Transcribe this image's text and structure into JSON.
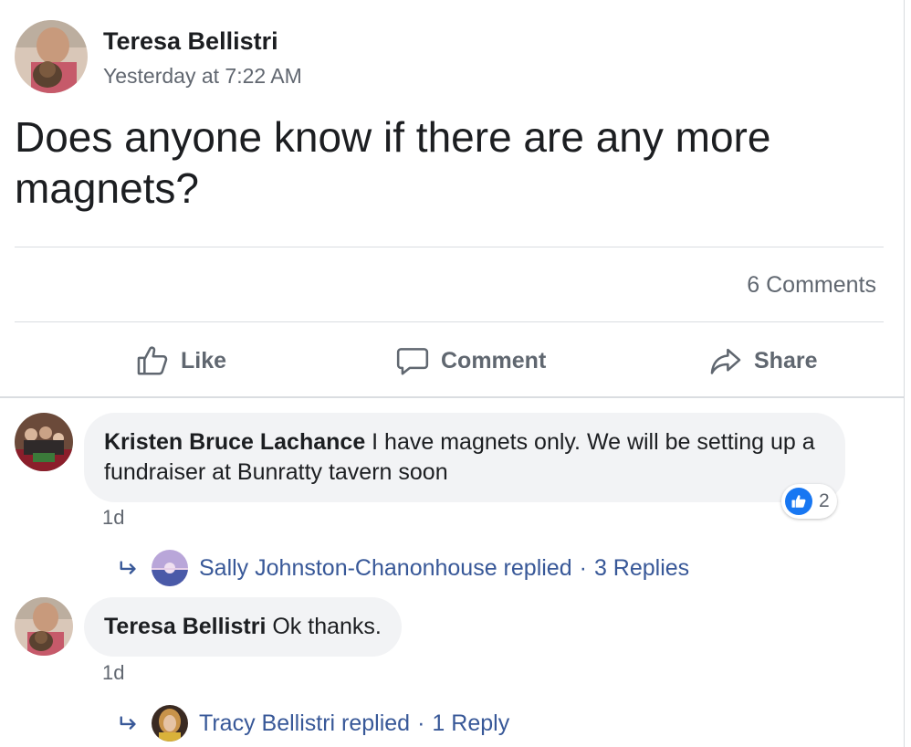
{
  "post": {
    "author": "Teresa Bellistri",
    "timestamp": "Yesterday at 7:22 AM",
    "text": "Does anyone know if there are any more magnets?",
    "comments_count": "6 Comments",
    "actions": {
      "like": "Like",
      "comment": "Comment",
      "share": "Share"
    }
  },
  "comments": [
    {
      "author": "Kristen Bruce Lachance",
      "text": " I have magnets only. We will be setting up a fundraiser at Bunratty tavern soon",
      "time": "1d",
      "reaction_count": "2",
      "reply_summary": {
        "text": "Sally Johnston-Chanonhouse replied",
        "separator": "·",
        "count": "3 Replies"
      }
    },
    {
      "author": "Teresa Bellistri",
      "text": " Ok thanks.",
      "time": "1d",
      "reply_summary": {
        "text": "Tracy Bellistri replied",
        "separator": "·",
        "count": "1 Reply"
      }
    }
  ],
  "colors": {
    "link": "#385898",
    "like_blue": "#1877f2",
    "bubble": "#f2f3f5",
    "muted": "#606770"
  },
  "icons": [
    "thumbs-up-icon",
    "comment-icon",
    "share-icon",
    "reply-arrow-icon",
    "like-reaction-icon"
  ]
}
